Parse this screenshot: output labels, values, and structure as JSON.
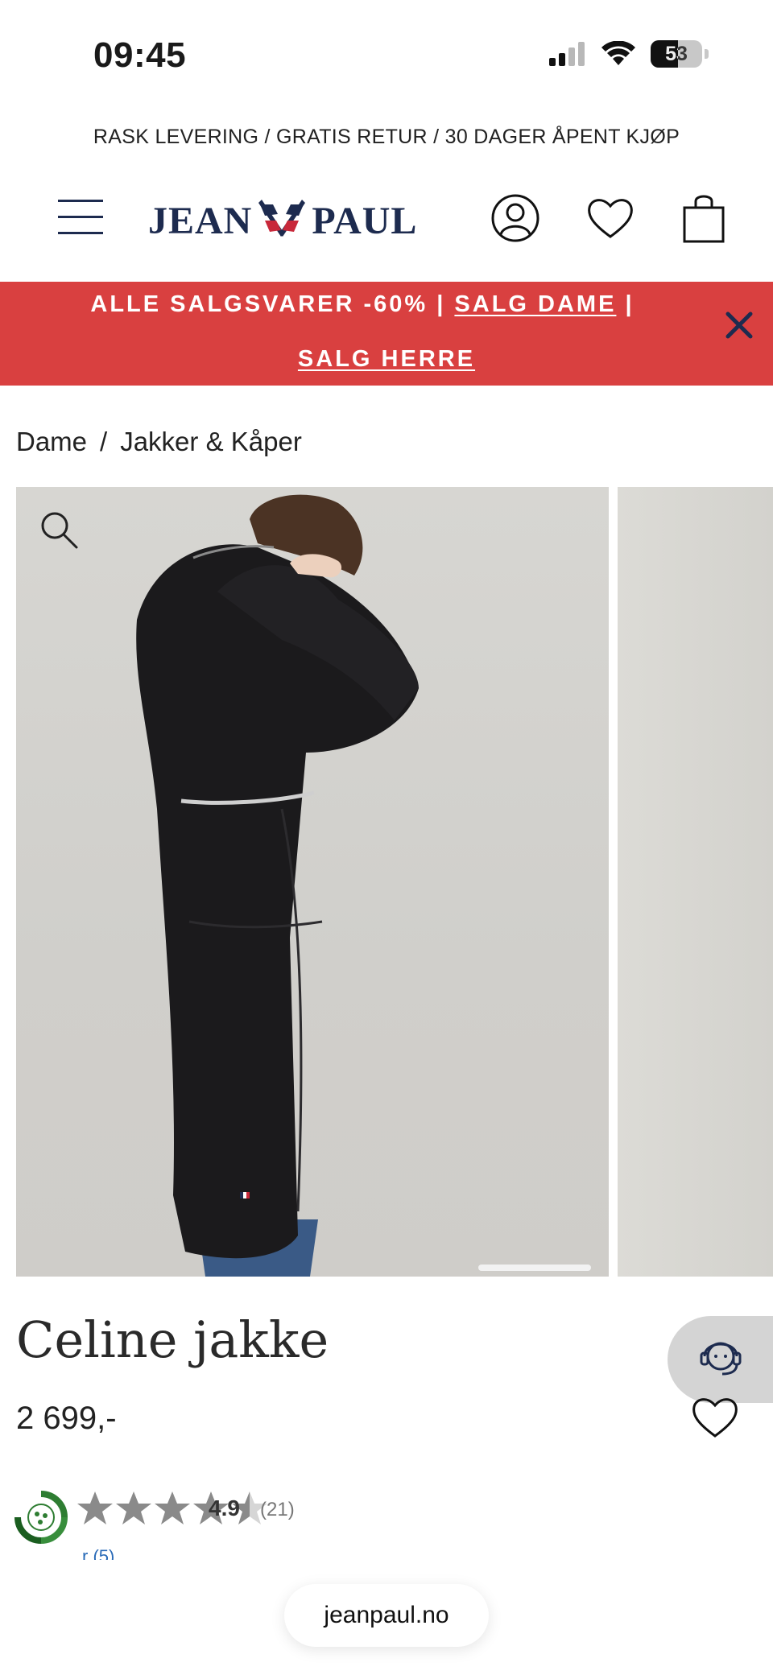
{
  "status_bar": {
    "time": "09:45",
    "battery_level": "53",
    "battery_fraction": 0.53
  },
  "promo": {
    "text": "RASK LEVERING / GRATIS RETUR / 30 DAGER ÅPENT KJØP"
  },
  "header": {
    "brand_left": "JEAN",
    "brand_right": "PAUL",
    "menu_icon": "hamburger-icon",
    "account_icon": "user-icon",
    "wishlist_icon": "heart-icon",
    "cart_icon": "shopping-bag-icon"
  },
  "sale_banner": {
    "text": "ALLE SALGSVARER -60% |",
    "link_dame": "SALG DAME",
    "separator": "|",
    "link_herre": "SALG HERRE",
    "background": "#d94040",
    "close_icon": "close-icon"
  },
  "breadcrumb": {
    "items": [
      "Dame",
      "Jakker & Kåper"
    ],
    "separator": "/"
  },
  "gallery": {
    "zoom_icon": "magnifier-icon"
  },
  "product": {
    "title": "Celine jakke",
    "price": "2 699,-",
    "rating": "4.9",
    "rating_count": "(21)",
    "rating_value": 4.5,
    "reviews_link": "r (5)",
    "chat_icon": "support-agent-icon",
    "eco_icon": "eco-badge-icon"
  },
  "browser": {
    "url": "jeanpaul.no"
  }
}
